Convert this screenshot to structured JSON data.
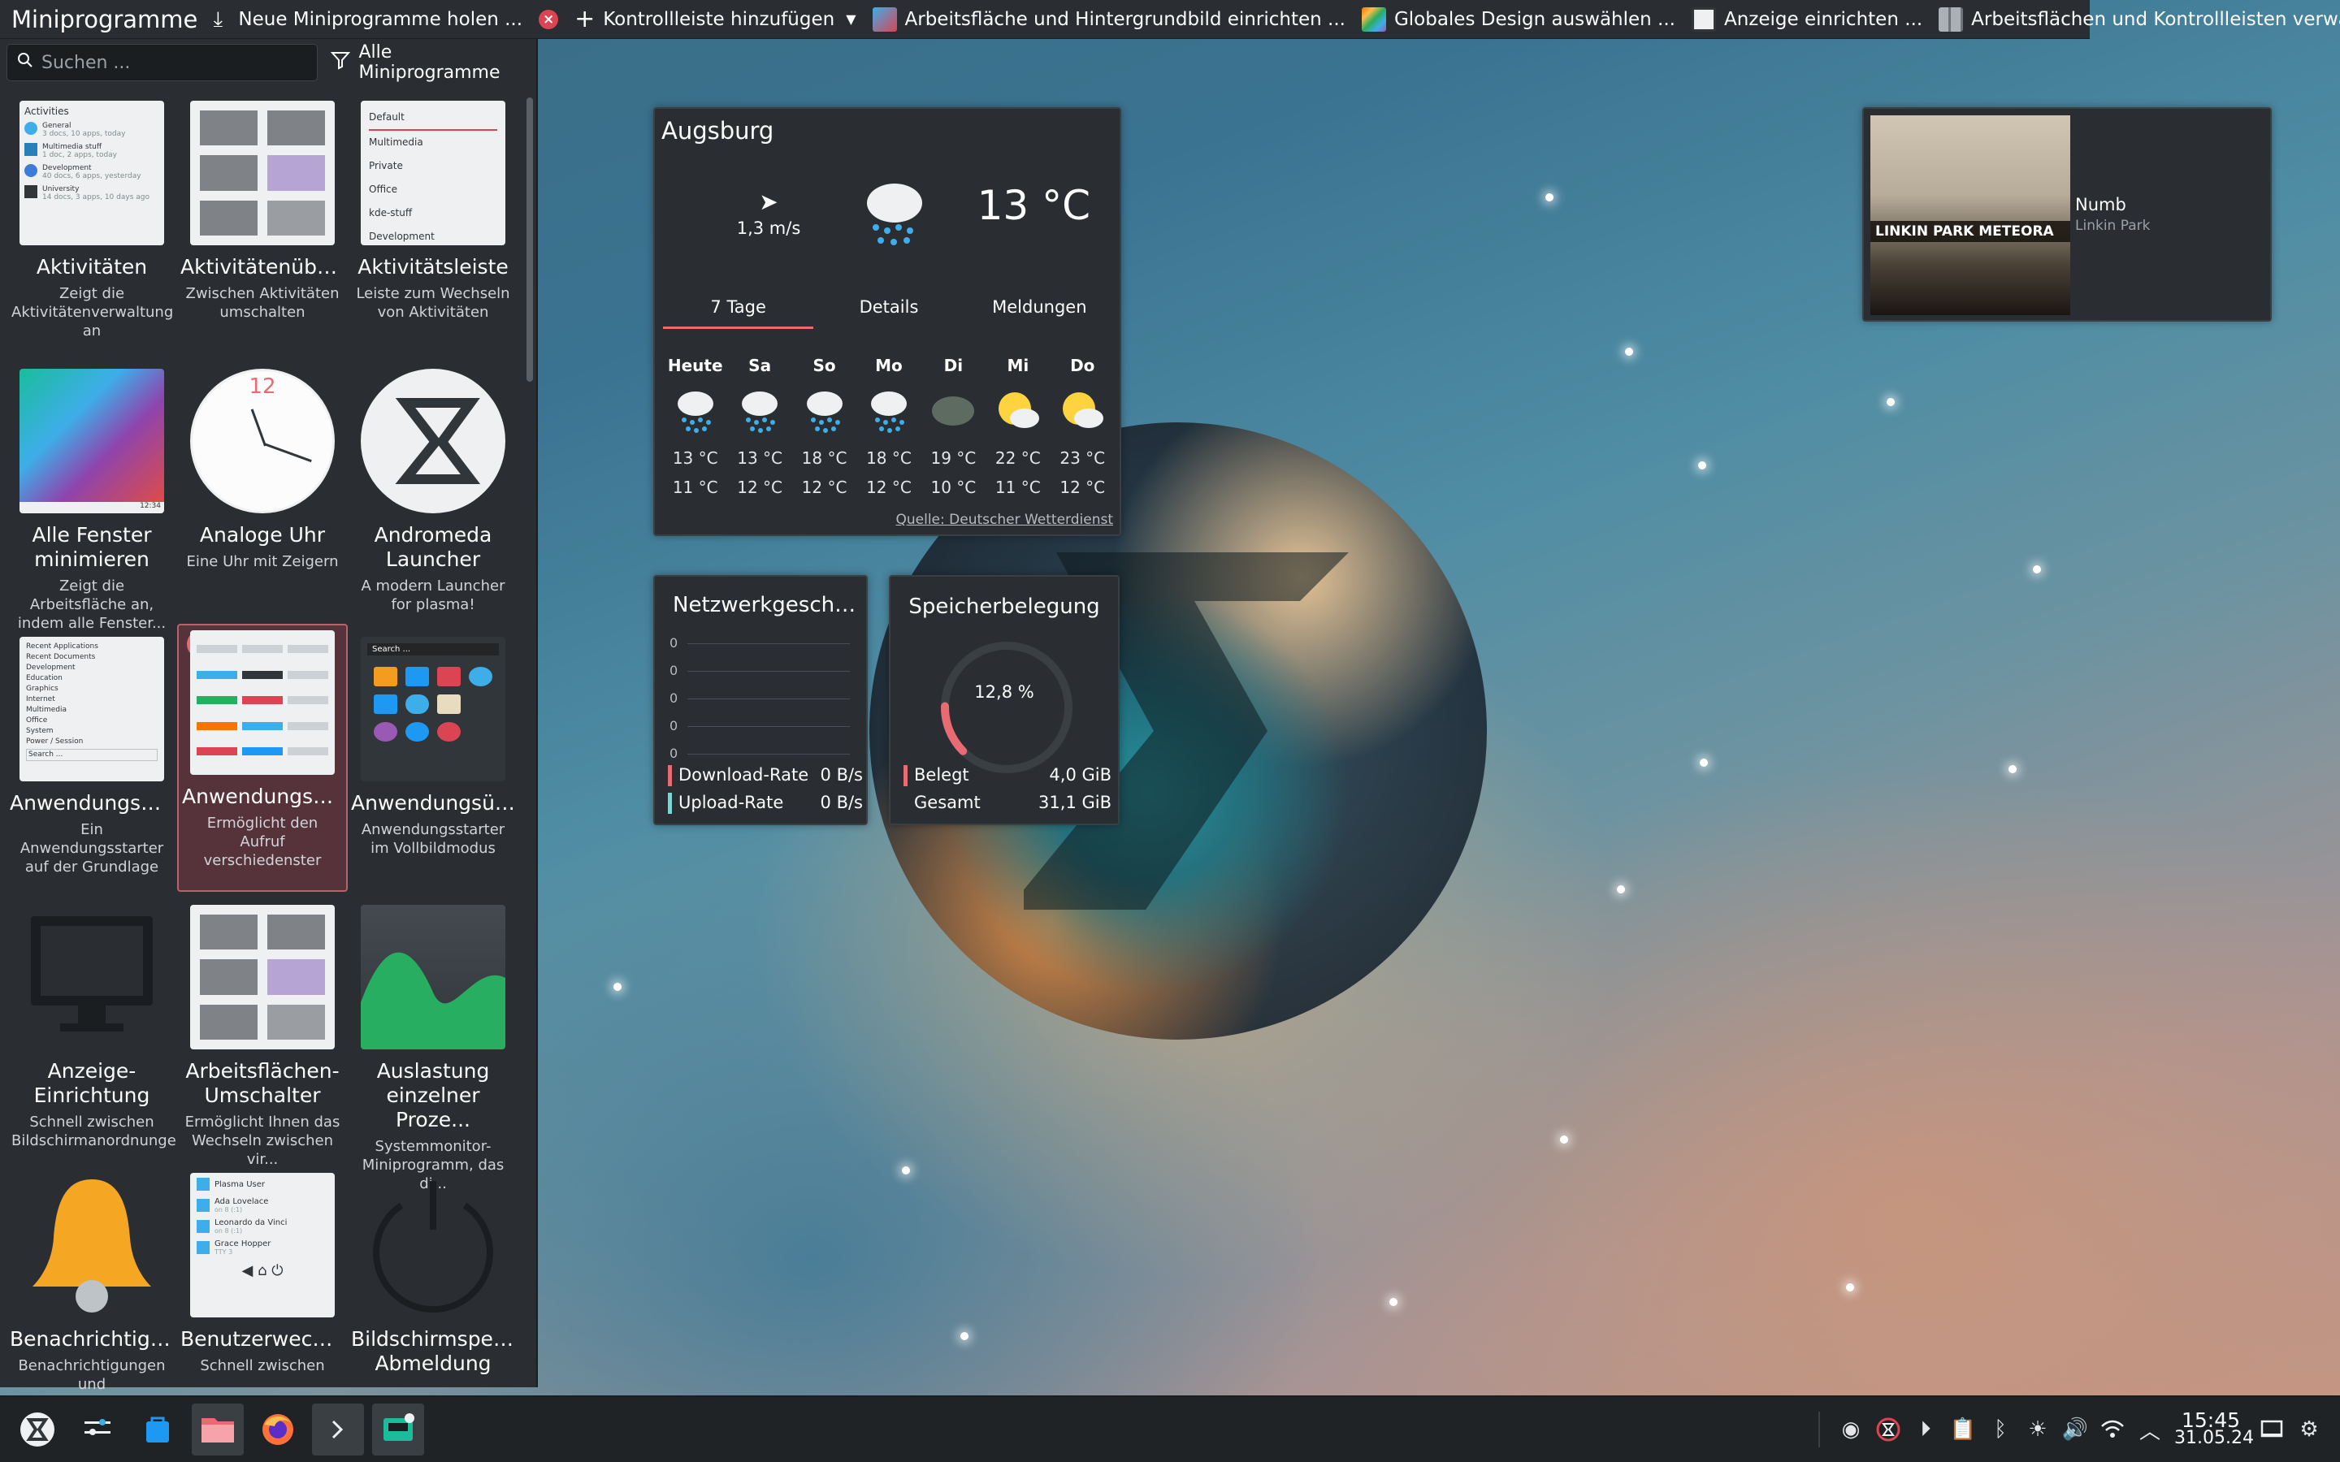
{
  "toolbar": {
    "title": "Miniprogramme",
    "get_new": "Neue Miniprogramme holen ...",
    "add_panel": "Kontrollleiste hinzufügen",
    "desktop_wallpaper": "Arbeitsfläche und Hintergrundbild einrichten ...",
    "global_theme": "Globales Design auswählen ...",
    "display": "Anzeige einrichten ...",
    "manage": "Arbeitsflächen und Kontrollleisten verwalten ..."
  },
  "widgets_panel": {
    "search_placeholder": "Suchen ...",
    "filter_label": "Alle Miniprogramme",
    "items": [
      {
        "name": "Aktivitäten",
        "desc": "Zeigt die Aktivitätenverwaltung an"
      },
      {
        "name": "Aktivitätenübers...",
        "desc": "Zwischen Aktivitäten umschalten"
      },
      {
        "name": "Aktivitätsleiste",
        "desc": "Leiste zum Wechseln von Aktivitäten"
      },
      {
        "name": "Alle Fenster minimieren",
        "desc": "Zeigt die Arbeitsfläche an, indem alle Fenster..."
      },
      {
        "name": "Analoge Uhr",
        "desc": "Eine Uhr mit Zeigern"
      },
      {
        "name": "Andromeda Launcher",
        "desc": "A modern Launcher for plasma!"
      },
      {
        "name": "Anwendungsme...",
        "desc": "Ein Anwendungsstarter auf der Grundlage von kaskadierenden Aufkl..."
      },
      {
        "name": "Anwendungssta...",
        "desc": "Ermöglicht den Aufruf verschiedenster Programme",
        "badge": "1"
      },
      {
        "name": "Anwendungsüb...",
        "desc": "Anwendungsstarter im Vollbildmodus"
      },
      {
        "name": "Anzeige-Einrichtung",
        "desc": "Schnell zwischen Bildschirmanordnunge..."
      },
      {
        "name": "Arbeitsflächen-Umschalter",
        "desc": "Ermöglicht Ihnen das Wechseln zwischen vir..."
      },
      {
        "name": "Auslastung einzelner Proze...",
        "desc": "Systemmonitor-Miniprogramm, das di..."
      },
      {
        "name": "Benachrichtigun...",
        "desc": "Benachrichtigungen und"
      },
      {
        "name": "Benutzerwechsel",
        "desc": "Schnell zwischen"
      },
      {
        "name": "Bildschirmsperre/ Abmeldung",
        "desc": ""
      }
    ],
    "activities_preview": {
      "header": "Activities",
      "rows": [
        {
          "name": "General",
          "sub": "3 docs, 10 apps, today"
        },
        {
          "name": "Multimedia stuff",
          "sub": "1 doc, 2 apps, today"
        },
        {
          "name": "Development",
          "sub": "40 docs, 6 apps, yesterday"
        },
        {
          "name": "University",
          "sub": "14 docs, 3 apps, 10 days ago"
        }
      ]
    },
    "activity_bar_preview": [
      "Default",
      "Multimedia",
      "Private",
      "Office",
      "kde-stuff",
      "Development"
    ],
    "menu_preview": [
      "Recent Applications",
      "Recent Documents",
      "Development",
      "Education",
      "Graphics",
      "Internet",
      "Multimedia",
      "Office",
      "System",
      "Power / Session"
    ],
    "menu_search": "Search ...",
    "dash_search": "Search ...",
    "user_switch_preview": [
      "Plasma User",
      "Ada Lovelace",
      "Leonardo da Vinci",
      "Grace Hopper"
    ],
    "user_switch_subs": [
      "",
      "on 8 (:1)",
      "on 8 (:1)",
      "TTY 3"
    ],
    "minimize_time": "12:34",
    "clock_mark": "12"
  },
  "weather": {
    "location": "Augsburg",
    "wind": "1,3 m/s",
    "temperature": "13 °C",
    "tabs": [
      "7 Tage",
      "Details",
      "Meldungen"
    ],
    "days": [
      {
        "day": "Heute",
        "high": "13 °C",
        "low": "11 °C",
        "icon": "rain-icon"
      },
      {
        "day": "Sa",
        "high": "13 °C",
        "low": "12 °C",
        "icon": "rain-icon"
      },
      {
        "day": "So",
        "high": "18 °C",
        "low": "12 °C",
        "icon": "rain-icon"
      },
      {
        "day": "Mo",
        "high": "18 °C",
        "low": "12 °C",
        "icon": "rain-icon"
      },
      {
        "day": "Di",
        "high": "19 °C",
        "low": "10 °C",
        "icon": "cloudy-icon"
      },
      {
        "day": "Mi",
        "high": "22 °C",
        "low": "11 °C",
        "icon": "sun-cloud-icon"
      },
      {
        "day": "Do",
        "high": "23 °C",
        "low": "12 °C",
        "icon": "sun-cloud-icon"
      }
    ],
    "source": "Quelle: Deutscher Wetterdienst"
  },
  "network": {
    "title": "Netzwerkgeschwi...",
    "grid_labels": [
      "0",
      "0",
      "0",
      "0",
      "0"
    ],
    "download_label": "Download-Rate",
    "download_value": "0 B/s",
    "upload_label": "Upload-Rate",
    "upload_value": "0 B/s",
    "download_color": "#e86a73",
    "upload_color": "#7fd3d0"
  },
  "memory": {
    "title": "Speicherbelegung",
    "percent_label": "12,8 %",
    "percent_value": 12.8,
    "used_label": "Belegt",
    "used_value": "4,0 GiB",
    "total_label": "Gesamt",
    "total_value": "31,1 GiB"
  },
  "media": {
    "song": "Numb",
    "artist": "Linkin Park",
    "cover_band": "LINKIN PARK  METEORA"
  },
  "taskbar": {
    "apps": [
      "kde-logo-icon",
      "settings-icon",
      "discover-icon",
      "file-manager-icon",
      "firefox-icon",
      "terminal-icon",
      "widget-app-icon"
    ],
    "clock_time": "15:45",
    "clock_date": "31.05.24"
  }
}
